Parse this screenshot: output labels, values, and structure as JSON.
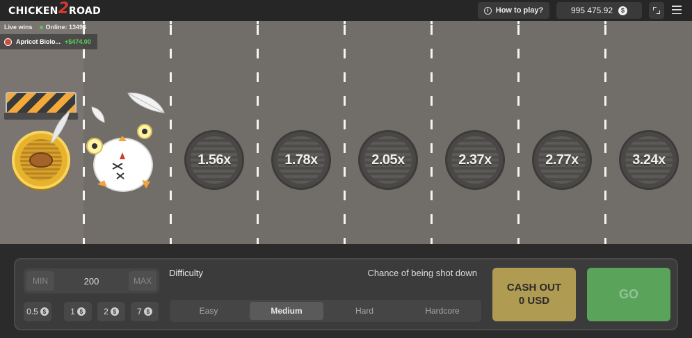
{
  "header": {
    "logo_part1": "CHICKEN",
    "logo_part2": "2",
    "logo_part3": "ROAD",
    "how_to_play": "How to play?",
    "balance": "995 475.92",
    "currency_symbol": "$"
  },
  "live": {
    "label": "Live wins",
    "online": "Online: 13496",
    "last_win": {
      "player": "Apricot Biolo...",
      "amount": "+$474.00"
    }
  },
  "lanes": [
    {
      "multiplier": "1.56x"
    },
    {
      "multiplier": "1.78x"
    },
    {
      "multiplier": "2.05x"
    },
    {
      "multiplier": "2.37x"
    },
    {
      "multiplier": "2.77x"
    },
    {
      "multiplier": "3.24x"
    }
  ],
  "controls": {
    "min_label": "MIN",
    "max_label": "MAX",
    "bet_value": "200",
    "quick_bets": [
      "0.5",
      "1",
      "2",
      "7"
    ],
    "difficulty_label": "Difficulty",
    "chance_label": "Chance of being shot down",
    "difficulties": [
      "Easy",
      "Medium",
      "Hard",
      "Hardcore"
    ],
    "selected_difficulty": "Medium",
    "cashout_line1": "CASH OUT",
    "cashout_line2": "0 USD",
    "go_label": "GO"
  },
  "colors": {
    "road": "#716d69",
    "go": "#5aa35a",
    "cashout": "#b09b52",
    "win_amount": "#5ad05a"
  }
}
